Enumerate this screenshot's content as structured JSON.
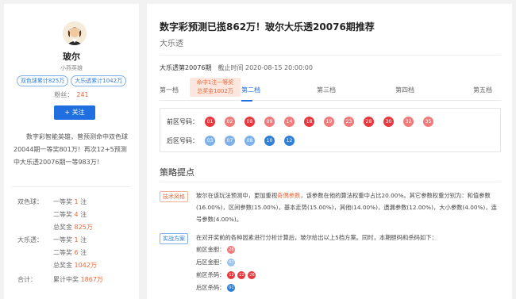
{
  "profile": {
    "name": "玻尔",
    "subtitle": "小燕英雄",
    "tags": [
      "双色球累计825万",
      "大乐透累计1042万"
    ],
    "fans_label": "粉丝：",
    "fans_count": "241",
    "follow_label": "+ 关注",
    "intro": "数字彩智能英雄，曾预测命中双色球20044期一等奖801万！再次12+5预测中大乐透20076期一等983万！"
  },
  "stats": [
    {
      "label": "双色球：",
      "item": "一等奖 ",
      "value": "1",
      "suffix": " 注"
    },
    {
      "label": "",
      "item": "二等奖 ",
      "value": "4",
      "suffix": " 注"
    },
    {
      "label": "",
      "item": "总奖金 ",
      "value": "825万",
      "suffix": ""
    },
    {
      "label": "大乐透：",
      "item": "一等奖 ",
      "value": "1",
      "suffix": " 注"
    },
    {
      "label": "",
      "item": "二等奖 ",
      "value": "6",
      "suffix": " 注"
    },
    {
      "label": "",
      "item": "总奖金 ",
      "value": "1042万",
      "suffix": ""
    },
    {
      "label": "合计：",
      "item": "累计中奖 ",
      "value": "1867万",
      "suffix": ""
    }
  ],
  "article": {
    "title": "数字彩预测已揽862万！玻尔大乐透20076期推荐",
    "subtitle": "大乐透",
    "issue": "大乐透第20076期",
    "deadline": "截止时间 2020-08-15 20:00:00"
  },
  "tabs": [
    {
      "label": "第一档"
    },
    {
      "label": "第二档"
    },
    {
      "label": "第三档"
    },
    {
      "label": "第四档"
    },
    {
      "label": "第五档"
    }
  ],
  "bubble": {
    "line1": "命中1注一等奖",
    "line2": "总奖金1002万"
  },
  "front_label": "前区号码：",
  "front_balls": [
    "01",
    "02",
    "08",
    "09",
    "14",
    "18",
    "19",
    "23",
    "28",
    "30",
    "32",
    "35"
  ],
  "back_label": "后区号码：",
  "back_balls": [
    "03",
    "07",
    "08",
    "10",
    "12"
  ],
  "section_title": "策略提点",
  "tip1": {
    "badge": "技术风格",
    "text_a": "玻尔在该玩法预测中，更加重视",
    "text_hl": "奇偶参数",
    "text_b": "，该参数在他的算法权重中占比20.00%。其它参数权重分别为：和值参数(16.00%)，区间参数(15.00%)，基本走势(15.00%)，其他(14.00%)，遗漏参数(12.00%)，大小参数(4.00%)，连号参数(4.00%)。"
  },
  "tip2": {
    "badge": "实战方案",
    "text": "在对开奖前的各种因素进行分析计算后，玻尔给出以上5档方案。同时，本期胆码和杀码如下：",
    "rows": [
      {
        "label": "前区金胆：",
        "balls": [
          "28"
        ]
      },
      {
        "label": "后区金胆：",
        "balls": [
          "07"
        ]
      },
      {
        "label": "前区杀码：",
        "balls": [
          "12",
          "22",
          "26"
        ]
      },
      {
        "label": "后区杀码：",
        "balls": [
          "01"
        ]
      }
    ]
  },
  "colors": {
    "front_ball_shades": [
      "#e8383d",
      "#f27a7a",
      "#e8383d",
      "#f27a7a",
      "#f27a7a",
      "#e8383d",
      "#f27a7a",
      "#f27a7a",
      "#e8383d",
      "#e8383d",
      "#f27a7a",
      "#f27a7a"
    ],
    "back_ball_shades": [
      "#7fb0ea",
      "#7fb0ea",
      "#7fb0ea",
      "#2f7fd8",
      "#2f7fd8"
    ],
    "accent": "#1f6fe0",
    "highlight": "#e96a3d"
  }
}
